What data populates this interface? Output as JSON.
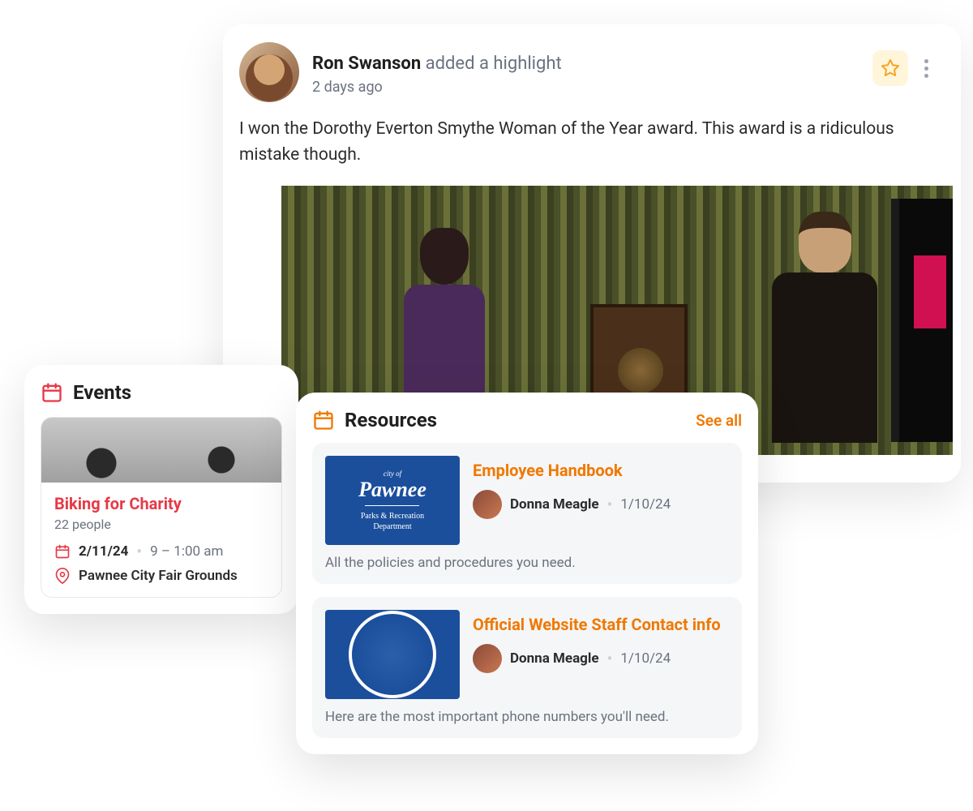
{
  "post": {
    "author": "Ron Swanson",
    "action": "added a highlight",
    "time": "2 days ago",
    "body": "I won the Dorothy Everton Smythe Woman of the Year award. This award is a ridiculous mistake though."
  },
  "events": {
    "heading": "Events",
    "item": {
      "title": "Biking for Charity",
      "people": "22 people",
      "date": "2/11/24",
      "time": "9 – 1:00 am",
      "location": "Pawnee City Fair Grounds"
    }
  },
  "resources": {
    "heading": "Resources",
    "see_all": "See all",
    "items": [
      {
        "title": "Employee Handbook",
        "author": "Donna Meagle",
        "date": "1/10/24",
        "desc": "All the policies and procedures you need."
      },
      {
        "title": "Official Website Staff Contact info",
        "author": "Donna Meagle",
        "date": "1/10/24",
        "desc": "Here are the most important phone numbers you'll need."
      }
    ]
  }
}
